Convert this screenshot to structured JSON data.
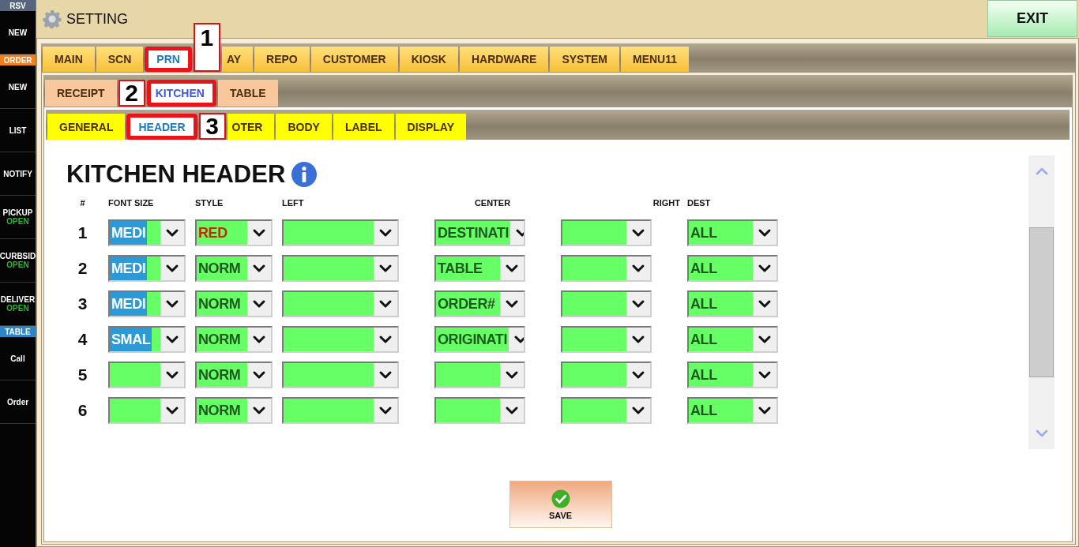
{
  "sidebar": {
    "groups": [
      {
        "title": "RSV",
        "color": "#56647e",
        "items": [
          {
            "label": "NEW"
          }
        ]
      },
      {
        "title": "ORDER",
        "color": "#f07f1f",
        "items": [
          {
            "label": "NEW"
          },
          {
            "label": "LIST"
          },
          {
            "label": "NOTIFY"
          },
          {
            "label": "PICKUP",
            "status": "OPEN"
          },
          {
            "label": "CURBSID",
            "status": "OPEN"
          },
          {
            "label": "DELIVER",
            "status": "OPEN"
          }
        ]
      },
      {
        "title": "TABLE",
        "color": "#2d86c4",
        "items": [
          {
            "label": "Call"
          },
          {
            "label": "Order"
          }
        ]
      }
    ]
  },
  "header": {
    "title": "SETTING",
    "exit_button": "EXIT"
  },
  "tab_bars": [
    {
      "kind": "main",
      "tabs": [
        {
          "label": "MAIN",
          "selected": false
        },
        {
          "label": "SCN",
          "selected": false
        },
        {
          "label": "PRN",
          "selected": true
        },
        {
          "label": "AY",
          "selected": false,
          "callout": "1"
        },
        {
          "label": "REPO",
          "selected": false
        },
        {
          "label": "CUSTOMER",
          "selected": false
        },
        {
          "label": "KIOSK",
          "selected": false
        },
        {
          "label": "HARDWARE",
          "selected": false
        },
        {
          "label": "SYSTEM",
          "selected": false
        },
        {
          "label": "MENU11",
          "selected": false
        }
      ]
    },
    {
      "kind": "sub",
      "tabs": [
        {
          "label": "RECEIPT",
          "selected": false
        },
        {
          "label": "KITCHEN",
          "selected": true,
          "callout": "2"
        },
        {
          "label": "TABLE",
          "selected": false
        }
      ]
    },
    {
      "kind": "section",
      "tabs": [
        {
          "label": "GENERAL",
          "selected": false
        },
        {
          "label": "HEADER",
          "selected": true
        },
        {
          "label": "OTER",
          "selected": false,
          "callout": "3"
        },
        {
          "label": "BODY",
          "selected": false
        },
        {
          "label": "LABEL",
          "selected": false
        },
        {
          "label": "DISPLAY",
          "selected": false
        }
      ]
    }
  ],
  "content": {
    "title": "KITCHEN HEADER",
    "columns": [
      "#",
      "FONT SIZE",
      "STYLE",
      "LEFT",
      "CENTER",
      "RIGHT",
      "DEST"
    ],
    "rows": [
      {
        "number": "1",
        "font_size": {
          "value": "MEDI",
          "highlighted": true
        },
        "style": {
          "value": "RED",
          "kind": "red"
        },
        "center": "DESTINATI",
        "dest": "ALL"
      },
      {
        "number": "2",
        "font_size": {
          "value": "MEDI",
          "highlighted": true
        },
        "style": {
          "value": "NORM",
          "kind": "normal"
        },
        "center": "TABLE",
        "dest": "ALL"
      },
      {
        "number": "3",
        "font_size": {
          "value": "MEDI",
          "highlighted": true
        },
        "style": {
          "value": "NORM",
          "kind": "normal"
        },
        "center": "ORDER#",
        "dest": "ALL"
      },
      {
        "number": "4",
        "font_size": {
          "value": "SMAL",
          "highlighted": true
        },
        "style": {
          "value": "NORM",
          "kind": "normal"
        },
        "center": "ORIGINATI",
        "dest": "ALL"
      },
      {
        "number": "5",
        "style": {
          "value": "NORM",
          "kind": "normal"
        },
        "dest": "ALL"
      },
      {
        "number": "6",
        "style": {
          "value": "NORM",
          "kind": "normal"
        },
        "dest": "ALL"
      }
    ],
    "save_button": "SAVE"
  }
}
